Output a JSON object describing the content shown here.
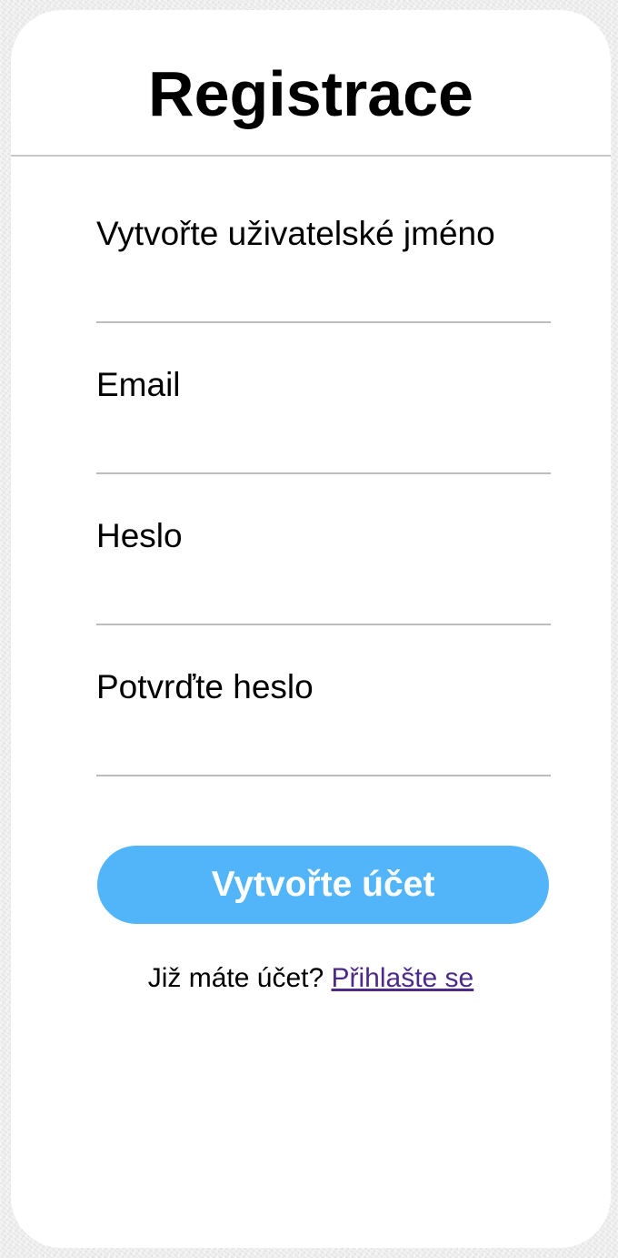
{
  "form": {
    "title": "Registrace",
    "fields": [
      {
        "label": "Vytvořte uživatelské jméno",
        "value": "",
        "type": "text"
      },
      {
        "label": "Email",
        "value": "",
        "type": "email"
      },
      {
        "label": "Heslo",
        "value": "",
        "type": "password"
      },
      {
        "label": "Potvrďte heslo",
        "value": "",
        "type": "password"
      }
    ],
    "submit_label": "Vytvořte účet",
    "login_prompt": "Již máte účet? ",
    "login_link": "Přihlašte se"
  },
  "colors": {
    "button": "#52b4f9",
    "link": "#4b2a8a",
    "divider": "#bdbdbd"
  }
}
